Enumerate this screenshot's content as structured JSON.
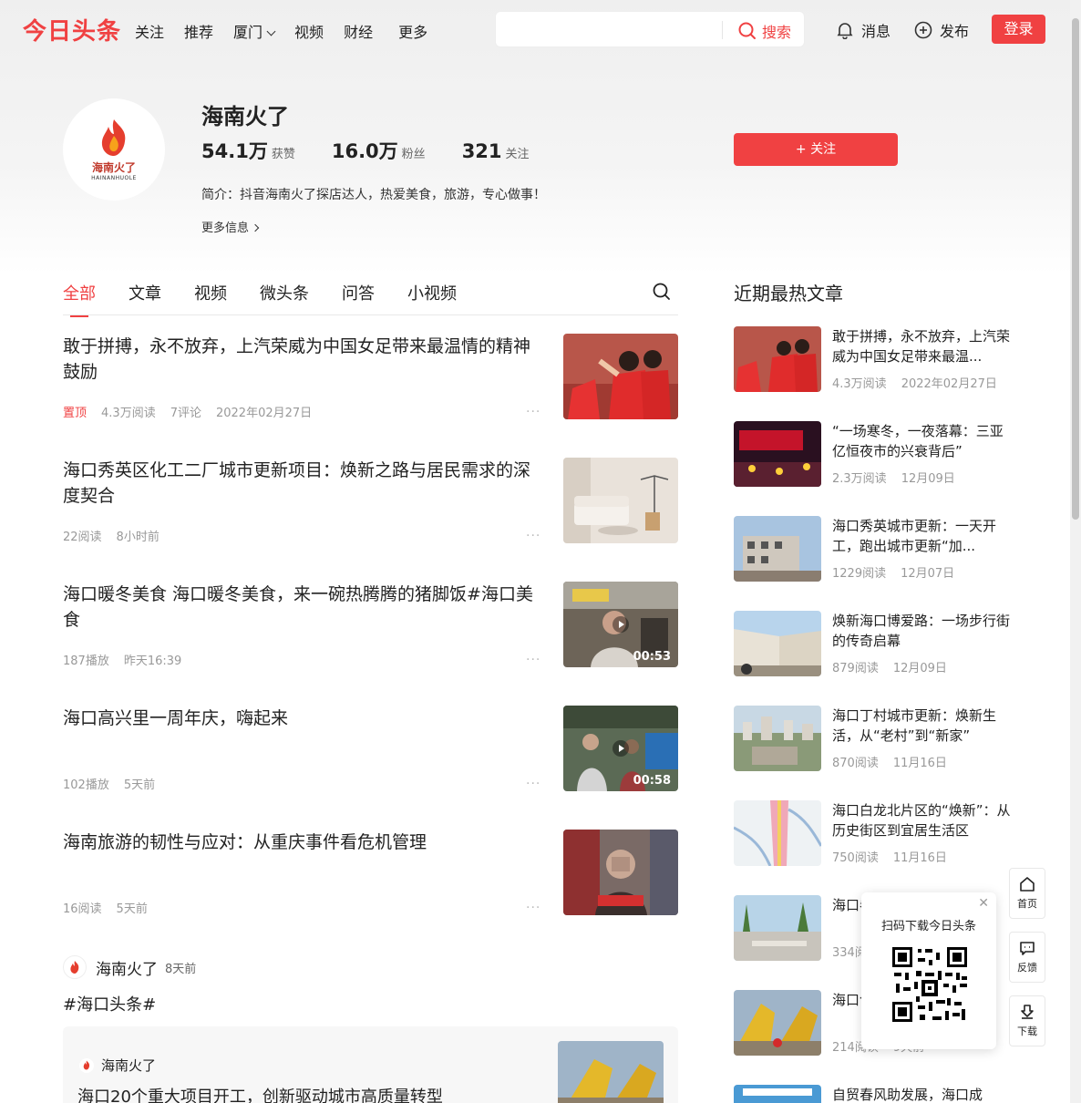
{
  "header": {
    "logo": "今日头条",
    "nav": [
      "关注",
      "推荐",
      "厦门",
      "视频",
      "财经",
      "更多"
    ],
    "search_placeholder": "",
    "search_label": "搜索",
    "messages_label": "消息",
    "publish_label": "发布",
    "login_label": "登录"
  },
  "profile": {
    "name": "海南火了",
    "avatar_text": "海南火了",
    "avatar_sub": "HAINANHUOLE",
    "likes": "54.1万",
    "likes_label": "获赞",
    "fans": "16.0万",
    "fans_label": "粉丝",
    "following": "321",
    "following_label": "关注",
    "bio": "简介：抖音海南火了探店达人，热爱美食，旅游，专心做事！",
    "more_info": "更多信息",
    "follow_label": "+ 关注"
  },
  "tabs": [
    "全部",
    "文章",
    "视频",
    "微头条",
    "问答",
    "小视频"
  ],
  "feed": [
    {
      "title": "敢于拼搏，永不放弃，上汽荣威为中国女足带来最温情的精神鼓励",
      "pin": "置顶",
      "reads": "4.3万阅读",
      "comments": "7评论",
      "time": "2022年02月27日"
    },
    {
      "title": "海口秀英区化工二厂城市更新项目：焕新之路与居民需求的深度契合",
      "reads": "22阅读",
      "time": "8小时前"
    },
    {
      "title": "海口暖冬美食 海口暖冬美食，来一碗热腾腾的猪脚饭#海口美食",
      "reads": "187播放",
      "time": "昨天16:39",
      "duration": "00:53"
    },
    {
      "title": "海口高兴里一周年庆，嗨起来",
      "reads": "102播放",
      "time": "5天前",
      "duration": "00:58"
    },
    {
      "title": "海南旅游的韧性与应对：从重庆事件看危机管理",
      "reads": "16阅读",
      "time": "5天前"
    }
  ],
  "post": {
    "author": "海南火了",
    "time": "8天前",
    "text": "#海口头条#",
    "quote_author": "海南火了",
    "quote_title": "海口20个重大项目开工，创新驱动城市高质量转型"
  },
  "sidebar": {
    "heading": "近期最热文章",
    "items": [
      {
        "title": "敢于拼搏，永不放弃，上汽荣威为中国女足带来最温...",
        "reads": "4.3万阅读",
        "time": "2022年02月27日"
      },
      {
        "title": "“一场寒冬，一夜落幕：三亚亿恒夜市的兴衰背后”",
        "reads": "2.3万阅读",
        "time": "12月09日"
      },
      {
        "title": "海口秀英城市更新：一天开工，跑出城市更新“加...",
        "reads": "1229阅读",
        "time": "12月07日"
      },
      {
        "title": "焕新海口博爱路：一场步行街的传奇启幕",
        "reads": "879阅读",
        "time": "12月09日"
      },
      {
        "title": "海口丁村城市更新：焕新生活，从“老村”到“新家”",
        "reads": "870阅读",
        "time": "11月16日"
      },
      {
        "title": "海口白龙北片区的“焕新”：从历史街区到宜居生活区",
        "reads": "750阅读",
        "time": "11月16日"
      },
      {
        "title": "海口卷：",
        "reads": "334阅",
        "time": ""
      },
      {
        "title": "海口创新",
        "reads": "214阅读",
        "time": "9天前"
      },
      {
        "title": "自贸春风助发展，海口成",
        "reads": "",
        "time": ""
      }
    ]
  },
  "qr": {
    "text": "扫码下载今日头条"
  },
  "float_buttons": [
    "首页",
    "反馈",
    "下载"
  ],
  "colors": {
    "brand": "#f04142"
  }
}
